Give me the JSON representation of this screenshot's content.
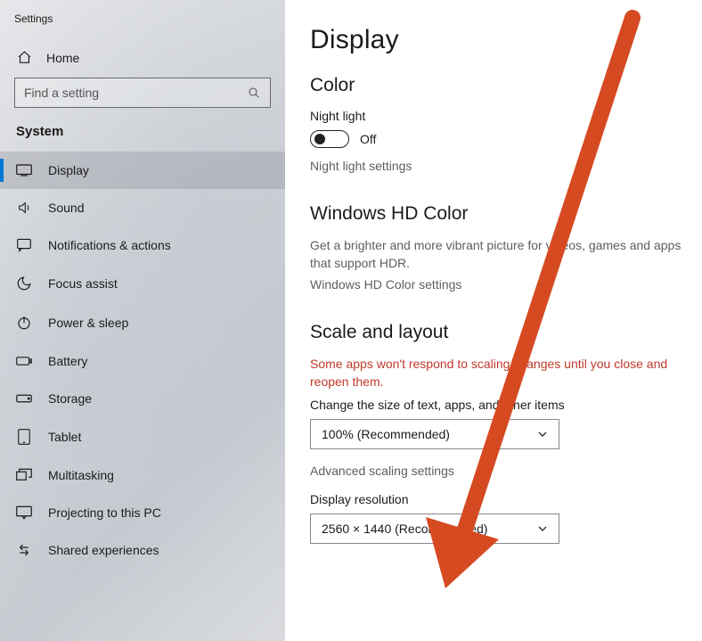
{
  "window": {
    "title": "Settings"
  },
  "sidebar": {
    "home_label": "Home",
    "search_placeholder": "Find a setting",
    "category": "System",
    "items": [
      {
        "key": "display",
        "label": "Display"
      },
      {
        "key": "sound",
        "label": "Sound"
      },
      {
        "key": "notifications",
        "label": "Notifications & actions"
      },
      {
        "key": "focus",
        "label": "Focus assist"
      },
      {
        "key": "power",
        "label": "Power & sleep"
      },
      {
        "key": "battery",
        "label": "Battery"
      },
      {
        "key": "storage",
        "label": "Storage"
      },
      {
        "key": "tablet",
        "label": "Tablet"
      },
      {
        "key": "multitasking",
        "label": "Multitasking"
      },
      {
        "key": "projecting",
        "label": "Projecting to this PC"
      },
      {
        "key": "shared",
        "label": "Shared experiences"
      }
    ]
  },
  "page": {
    "title": "Display",
    "color": {
      "heading": "Color",
      "night_light_label": "Night light",
      "night_light_state": "Off",
      "night_light_settings": "Night light settings"
    },
    "hdr": {
      "heading": "Windows HD Color",
      "description": "Get a brighter and more vibrant picture for videos, games and apps that support HDR.",
      "link": "Windows HD Color settings"
    },
    "scale": {
      "heading": "Scale and layout",
      "warning": "Some apps won't respond to scaling changes until you close and reopen them.",
      "text_size_label": "Change the size of text, apps, and other items",
      "text_size_value": "100% (Recommended)",
      "advanced_link": "Advanced scaling settings",
      "resolution_label": "Display resolution",
      "resolution_value": "2560 × 1440 (Recommended)"
    }
  },
  "annotation": {
    "type": "arrow",
    "color": "#d64a22"
  }
}
